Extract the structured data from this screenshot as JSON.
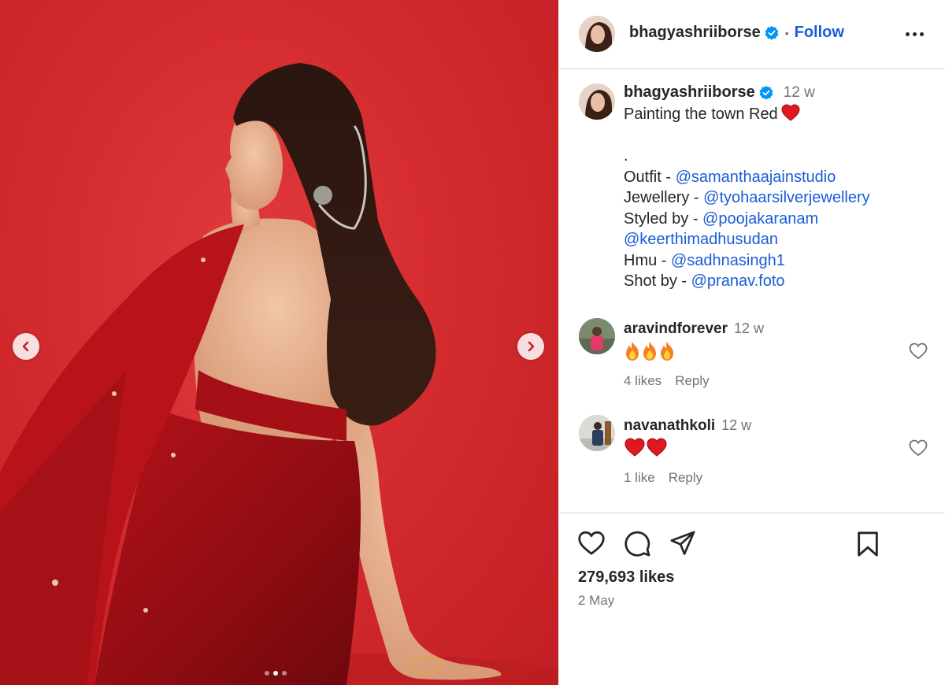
{
  "post": {
    "username": "bhagyashriiborse",
    "verified": true,
    "follow_label": "Follow",
    "separator": "•",
    "caption_time": "12 w",
    "caption_title": "Painting the town Red",
    "caption_dot": ".",
    "credits": [
      {
        "label": "Outfit - ",
        "mention": "@samanthaajainstudio"
      },
      {
        "label": "Jewellery - ",
        "mention": "@tyohaarsilverjewellery"
      },
      {
        "label": "Styled by - ",
        "mention": "@poojakaranam"
      },
      {
        "label": "",
        "mention": "@keerthimadhusudan"
      },
      {
        "label": "Hmu - ",
        "mention": "@sadhnasingh1"
      },
      {
        "label": "Shot by - ",
        "mention": "@pranav.foto"
      }
    ],
    "likes": "279,693 likes",
    "date": "2 May"
  },
  "comments": [
    {
      "username": "aravindforever",
      "time": "12 w",
      "emoji": [
        "fire",
        "fire",
        "fire"
      ],
      "likes": "4 likes",
      "reply": "Reply"
    },
    {
      "username": "navanathkoli",
      "time": "12 w",
      "emoji": [
        "heart",
        "heart"
      ],
      "likes": "1 like",
      "reply": "Reply"
    }
  ],
  "carousel": {
    "slide_count": 3,
    "active_index": 1
  },
  "colors": {
    "link": "#1a5cd8",
    "verified": "#0095f6",
    "background_red": "#d42b2f",
    "heart": "#e0181f",
    "muted": "#737373"
  }
}
